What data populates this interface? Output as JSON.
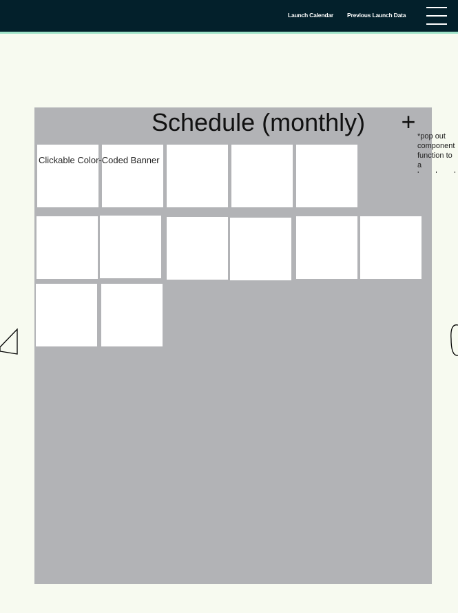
{
  "header": {
    "nav": [
      {
        "label": "Launch Calendar"
      },
      {
        "label": "Previous Launch Data"
      }
    ],
    "menu_icon": "hamburger-menu-icon"
  },
  "schedule": {
    "title": "Schedule (monthly)",
    "add_label": "+",
    "note": "*pop out\ncomponent\nfunction to a\nlaunch pack",
    "banner_label": "Clickable Color-Coded Banner"
  },
  "icons": {
    "left": "prev-arrow-icon",
    "right": "next-arrow-icon"
  },
  "colors": {
    "header_bg": "#03202b",
    "header_accent": "#9fe3c9",
    "panel_bg": "#b2b3b6",
    "page_bg": "#f7faf0"
  }
}
